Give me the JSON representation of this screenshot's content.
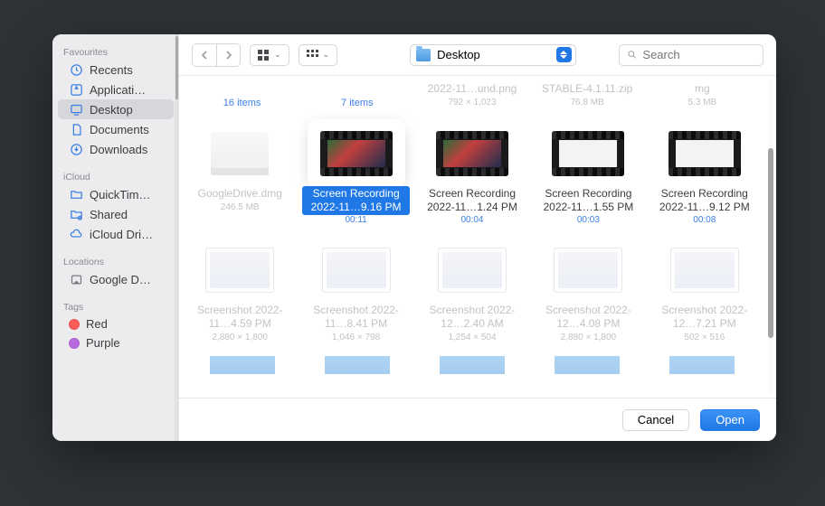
{
  "sidebar": {
    "sections": {
      "favourites": {
        "title": "Favourites",
        "items": [
          {
            "label": "Recents",
            "icon": "clock"
          },
          {
            "label": "Applicati…",
            "icon": "apps"
          },
          {
            "label": "Desktop",
            "icon": "desktop",
            "active": true
          },
          {
            "label": "Documents",
            "icon": "doc"
          },
          {
            "label": "Downloads",
            "icon": "down"
          }
        ]
      },
      "icloud": {
        "title": "iCloud",
        "items": [
          {
            "label": "QuickTim…",
            "icon": "folder"
          },
          {
            "label": "Shared",
            "icon": "shared"
          },
          {
            "label": "iCloud Dri…",
            "icon": "cloud"
          }
        ]
      },
      "locations": {
        "title": "Locations",
        "items": [
          {
            "label": "Google D…",
            "icon": "disk"
          }
        ]
      },
      "tags": {
        "title": "Tags",
        "items": [
          {
            "label": "Red",
            "color": "#fc5b57"
          },
          {
            "label": "Purple",
            "color": "#b869de"
          }
        ]
      }
    }
  },
  "toolbar": {
    "location": "Desktop",
    "search_placeholder": "Search"
  },
  "rows": {
    "top_faded": [
      {
        "name": "",
        "meta": "16 items",
        "count": true,
        "kind": "folder"
      },
      {
        "name": "",
        "meta": "7 items",
        "count": true,
        "kind": "folder"
      },
      {
        "name": "2022-11…und.png",
        "meta": "792 × 1,023",
        "kind": "img"
      },
      {
        "name": "STABLE-4.1.11.zip",
        "meta": "76.8 MB",
        "kind": "zip"
      },
      {
        "name": "mg",
        "meta": "5.3 MB",
        "kind": "img"
      }
    ],
    "row1": [
      {
        "name": "GoogleDrive.dmg",
        "meta": "246.5 MB",
        "kind": "dmg",
        "faded": true
      },
      {
        "name": "Screen Recording 2022-11…9.16 PM",
        "meta": "00:11",
        "kind": "vid",
        "selected": true,
        "dur": true
      },
      {
        "name": "Screen Recording 2022-11…1.24 PM",
        "meta": "00:04",
        "kind": "vid",
        "dur": true
      },
      {
        "name": "Screen Recording 2022-11…1.55 PM",
        "meta": "00:03",
        "kind": "vidw",
        "dur": true
      },
      {
        "name": "Screen Recording 2022-11…9.12 PM",
        "meta": "00:08",
        "kind": "vidw",
        "dur": true
      }
    ],
    "row2": [
      {
        "name": "Screenshot 2022-11…4.59 PM",
        "meta": "2,880 × 1,800",
        "kind": "shot",
        "faded": true
      },
      {
        "name": "Screenshot 2022-11…8.41 PM",
        "meta": "1,046 × 798",
        "kind": "shot",
        "faded": true
      },
      {
        "name": "Screenshot 2022-12…2.40 AM",
        "meta": "1,254 × 504",
        "kind": "shot",
        "faded": true
      },
      {
        "name": "Screenshot 2022-12…4.08 PM",
        "meta": "2,880 × 1,800",
        "kind": "shot",
        "faded": true
      },
      {
        "name": "Screenshot 2022-12…7.21 PM",
        "meta": "502 × 516",
        "kind": "shot",
        "faded": true
      }
    ],
    "partial": [
      {
        "kind": "folder"
      },
      {
        "kind": "folder"
      },
      {
        "kind": "folder"
      },
      {
        "kind": "folder"
      },
      {
        "kind": "folder"
      }
    ]
  },
  "footer": {
    "cancel": "Cancel",
    "open": "Open"
  }
}
